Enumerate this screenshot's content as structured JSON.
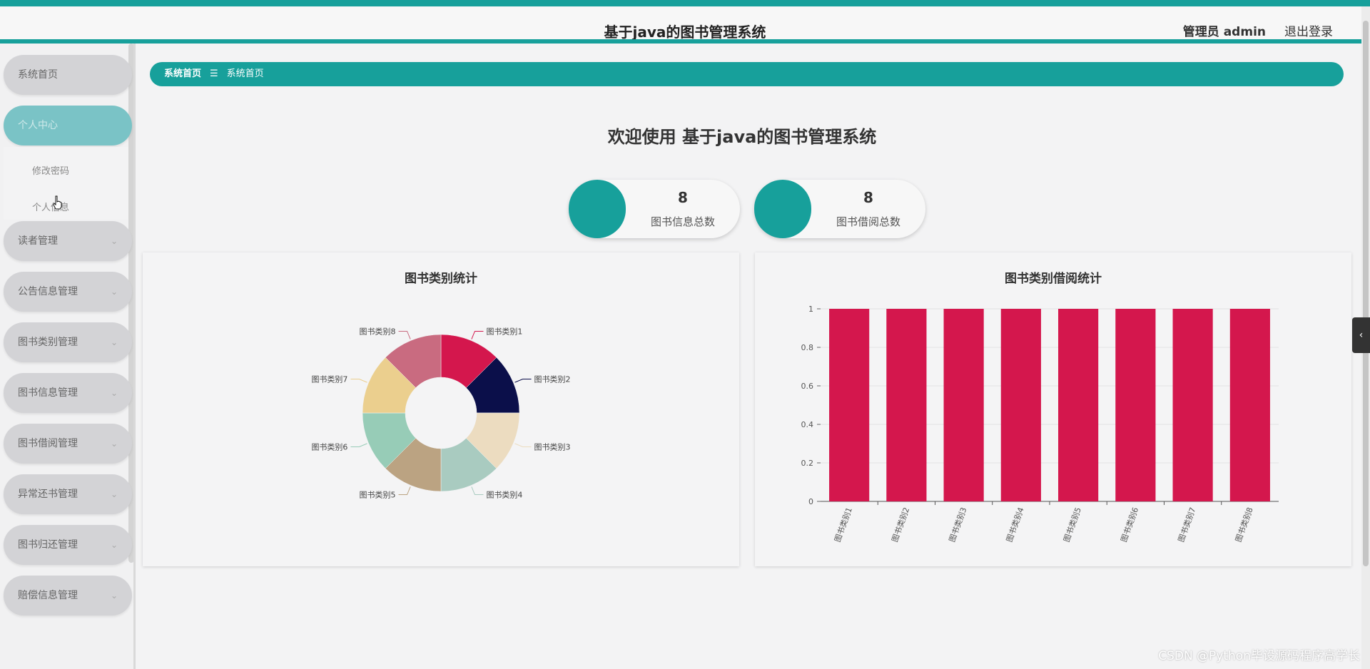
{
  "header": {
    "title": "基于java的图书管理系统",
    "user": "管理员 admin",
    "logout": "退出登录"
  },
  "sidebar": {
    "items": [
      {
        "label": "系统首页",
        "has_arrow": false
      },
      {
        "label": "个人中心",
        "has_arrow": false
      },
      {
        "label": "读者管理",
        "has_arrow": true
      },
      {
        "label": "公告信息管理",
        "has_arrow": true
      },
      {
        "label": "图书类别管理",
        "has_arrow": true
      },
      {
        "label": "图书信息管理",
        "has_arrow": true
      },
      {
        "label": "图书借阅管理",
        "has_arrow": true
      },
      {
        "label": "异常还书管理",
        "has_arrow": true
      },
      {
        "label": "图书归还管理",
        "has_arrow": true
      },
      {
        "label": "赔偿信息管理",
        "has_arrow": true
      }
    ],
    "submenu": [
      "修改密码",
      "个人信息"
    ]
  },
  "breadcrumb": {
    "root": "系统首页",
    "separator": "☰",
    "current": "系统首页"
  },
  "welcome": "欢迎使用 基于java的图书管理系统",
  "stats": [
    {
      "value": "8",
      "label": "图书信息总数"
    },
    {
      "value": "8",
      "label": "图书借阅总数"
    }
  ],
  "colors": {
    "accent": "#17a09b",
    "bar": "#d4174d"
  },
  "chart_data": [
    {
      "type": "pie",
      "title": "图书类别统计",
      "categories": [
        "图书类别1",
        "图书类别2",
        "图书类别3",
        "图书类别4",
        "图书类别5",
        "图书类别6",
        "图书类别7",
        "图书类别8"
      ],
      "values": [
        1,
        1,
        1,
        1,
        1,
        1,
        1,
        1
      ],
      "colors": [
        "#d4174d",
        "#0b0f4a",
        "#ecdcc0",
        "#a9cbc0",
        "#bba382",
        "#97ccb7",
        "#ebcf8e",
        "#c96b80"
      ],
      "donut": true
    },
    {
      "type": "bar",
      "title": "图书类别借阅统计",
      "categories": [
        "图书类别1",
        "图书类别2",
        "图书类别3",
        "图书类别4",
        "图书类别5",
        "图书类别6",
        "图书类别7",
        "图书类别8"
      ],
      "values": [
        1,
        1,
        1,
        1,
        1,
        1,
        1,
        1
      ],
      "ylim": [
        0,
        1
      ],
      "yticks": [
        "0",
        "0.2",
        "0.4",
        "0.6",
        "0.8",
        "1"
      ],
      "grid": true
    }
  ],
  "watermark": "CSDN @Python毕设源码程序高学长"
}
